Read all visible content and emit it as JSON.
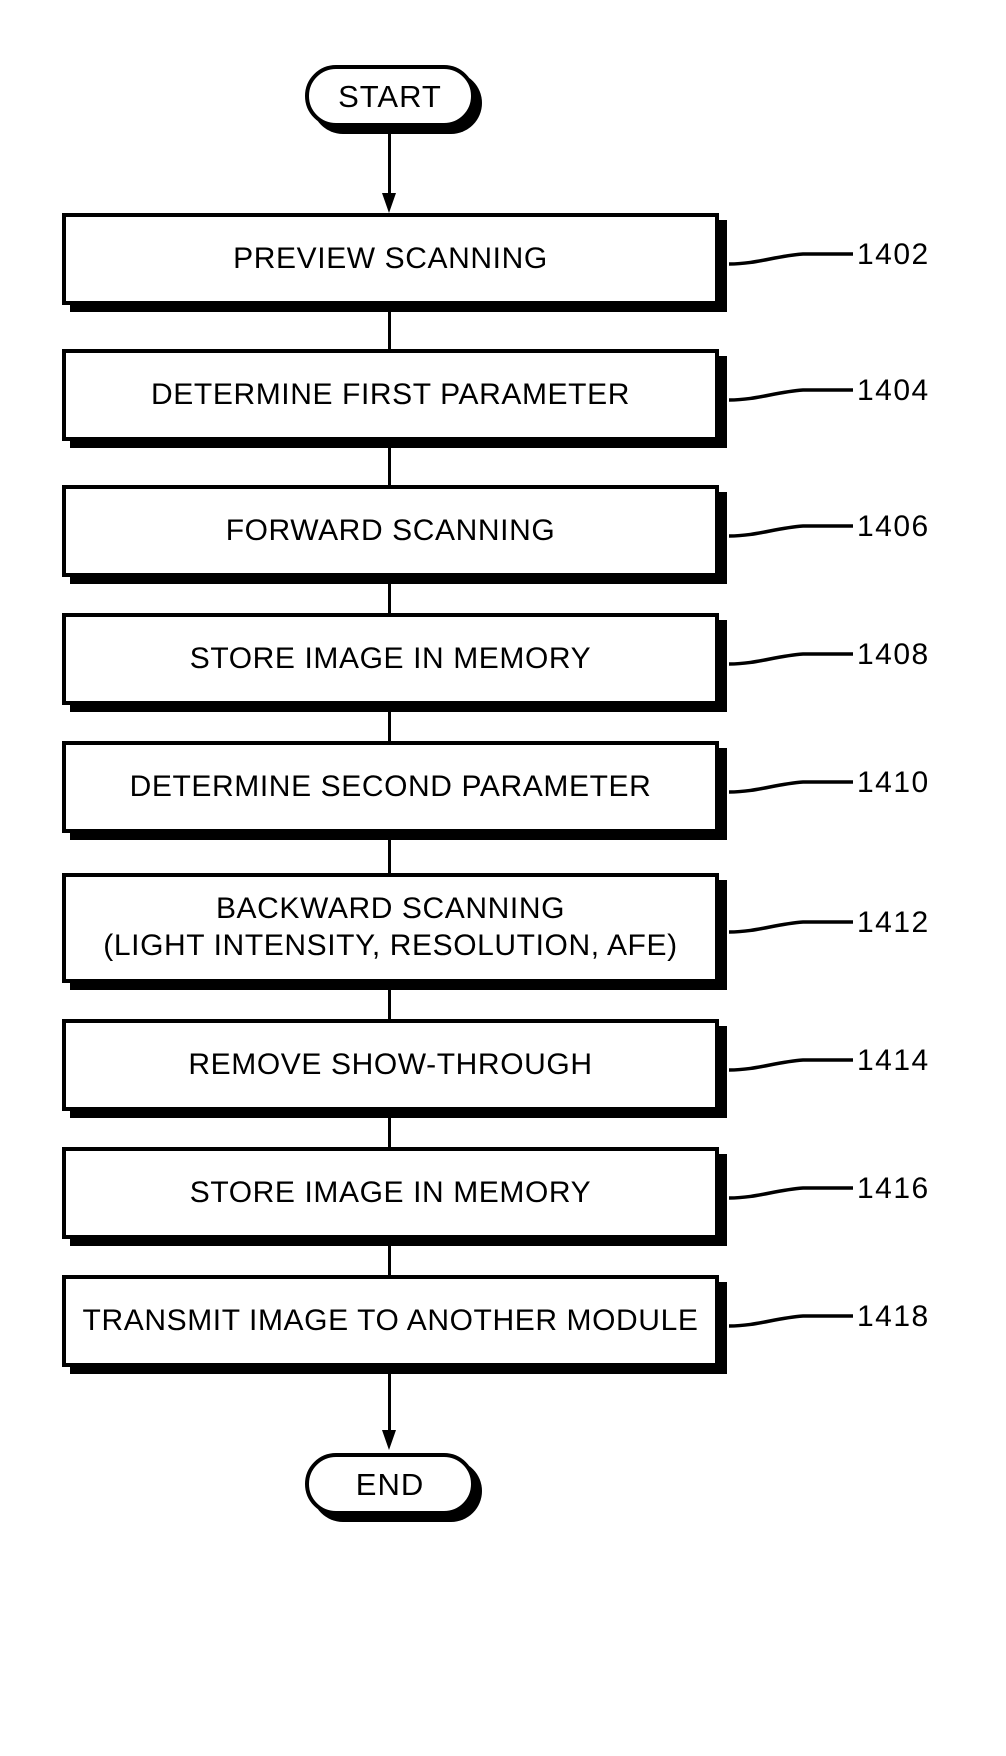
{
  "figure": {
    "type": "flowchart",
    "orientation": "vertical",
    "title": "",
    "start_label": "START",
    "end_label": "END"
  },
  "nodes": [
    {
      "id": "start",
      "shape": "terminal",
      "label": "START",
      "ref": ""
    },
    {
      "id": "n1402",
      "shape": "process",
      "label": "PREVIEW SCANNING",
      "label2": "",
      "ref": "1402"
    },
    {
      "id": "n1404",
      "shape": "process",
      "label": "DETERMINE FIRST PARAMETER",
      "label2": "",
      "ref": "1404"
    },
    {
      "id": "n1406",
      "shape": "process",
      "label": "FORWARD SCANNING",
      "label2": "",
      "ref": "1406"
    },
    {
      "id": "n1408",
      "shape": "process",
      "label": "STORE IMAGE IN MEMORY",
      "label2": "",
      "ref": "1408"
    },
    {
      "id": "n1410",
      "shape": "process",
      "label": "DETERMINE SECOND PARAMETER",
      "label2": "",
      "ref": "1410"
    },
    {
      "id": "n1412",
      "shape": "process",
      "label": "BACKWARD SCANNING",
      "label2": "(LIGHT INTENSITY, RESOLUTION, AFE)",
      "ref": "1412"
    },
    {
      "id": "n1414",
      "shape": "process",
      "label": "REMOVE SHOW-THROUGH",
      "label2": "",
      "ref": "1414"
    },
    {
      "id": "n1416",
      "shape": "process",
      "label": "STORE IMAGE IN MEMORY",
      "label2": "",
      "ref": "1416"
    },
    {
      "id": "n1418",
      "shape": "process",
      "label": "TRANSMIT IMAGE TO ANOTHER MODULE",
      "label2": "",
      "ref": "1418"
    },
    {
      "id": "end",
      "shape": "terminal",
      "label": "END",
      "ref": ""
    }
  ],
  "refs": {
    "r1402": "1402",
    "r1404": "1404",
    "r1406": "1406",
    "r1408": "1408",
    "r1410": "1410",
    "r1412": "1412",
    "r1414": "1414",
    "r1416": "1416",
    "r1418": "1418"
  },
  "labels": {
    "start": "START",
    "end": "END",
    "s1402": "PREVIEW SCANNING",
    "s1404": "DETERMINE FIRST PARAMETER",
    "s1406": "FORWARD SCANNING",
    "s1408": "STORE IMAGE IN MEMORY",
    "s1410": "DETERMINE SECOND PARAMETER",
    "s1412a": "BACKWARD SCANNING",
    "s1412b": "(LIGHT INTENSITY, RESOLUTION, AFE)",
    "s1414": "REMOVE SHOW-THROUGH",
    "s1416": "STORE IMAGE IN MEMORY",
    "s1418": "TRANSMIT IMAGE TO ANOTHER MODULE"
  },
  "colors": {
    "stroke": "#000000",
    "fill": "#ffffff",
    "background": "#ffffff"
  }
}
